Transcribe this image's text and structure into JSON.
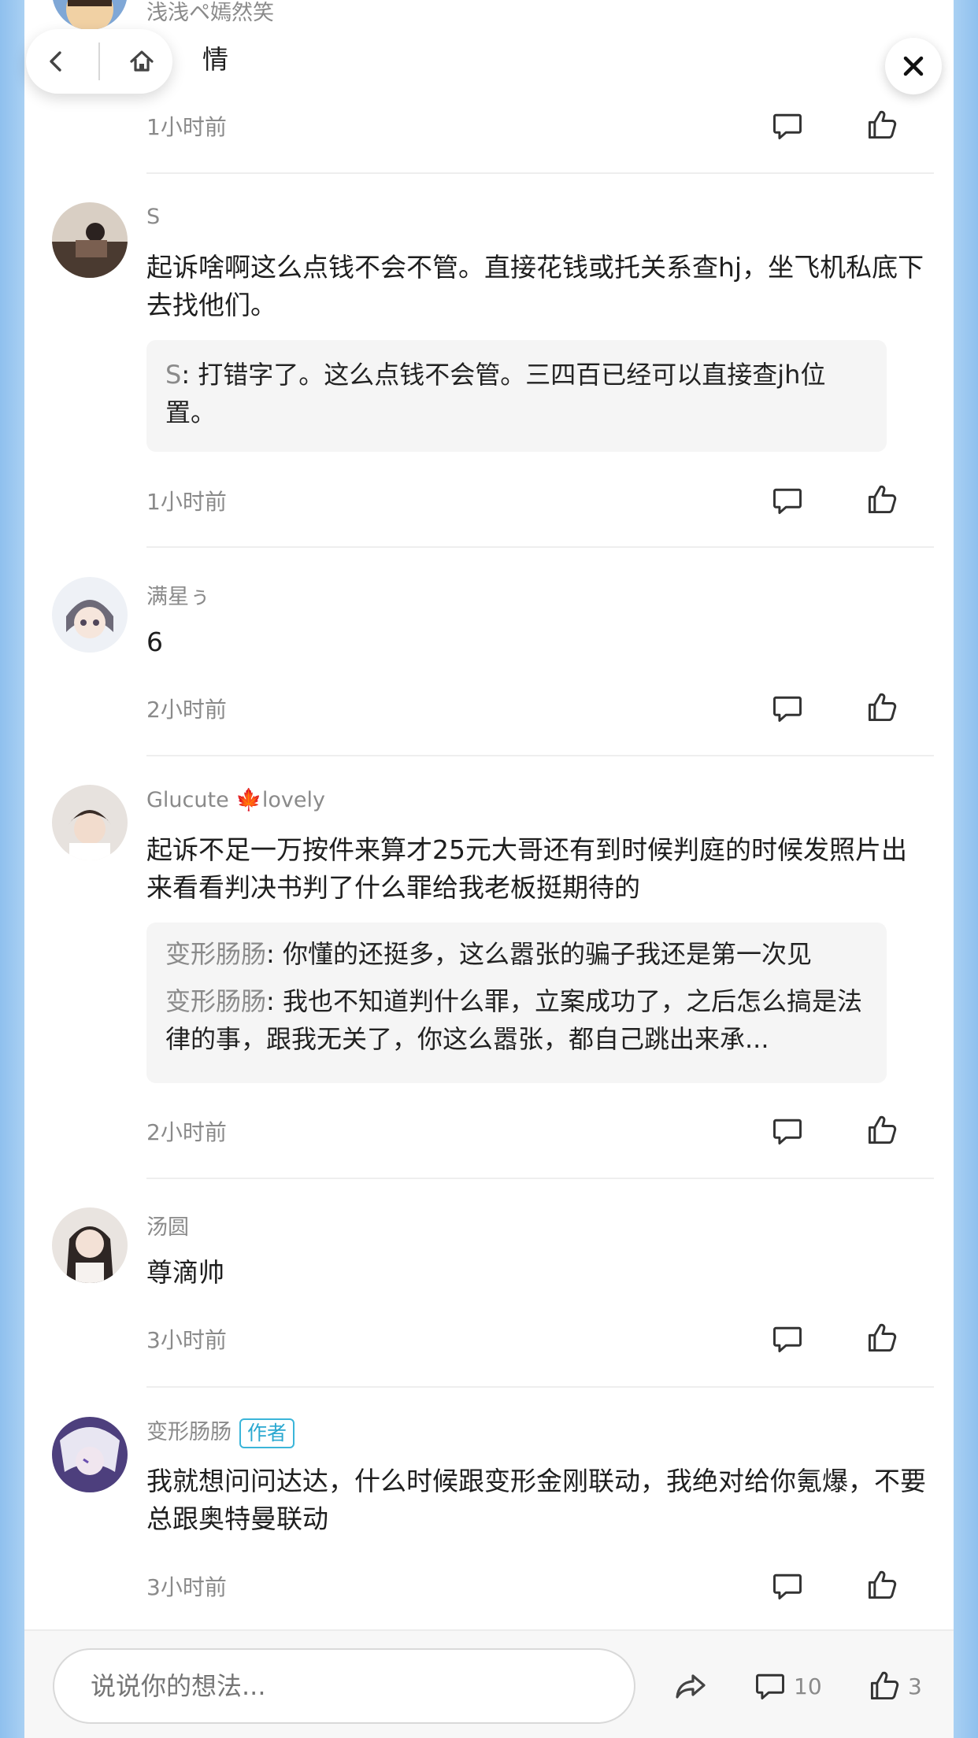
{
  "top_partial": {
    "author": "浅浅ペ嫣然笑",
    "text": "情",
    "time": "1小时前"
  },
  "comments": [
    {
      "author": "S",
      "text": "起诉啥啊这么点钱不会不管。直接花钱或托关系查hj，坐飞机私底下去找他们。",
      "replies": [
        {
          "name": "S",
          "text": "打错字了。这么点钱不会管。三四百已经可以直接查jh位置。"
        }
      ],
      "time": "1小时前"
    },
    {
      "author": "满星ぅ",
      "text": "6",
      "time": "2小时前"
    },
    {
      "author": "Glucute 🍁lovely",
      "text": "起诉不足一万按件来算才25元大哥还有到时候判庭的时候发照片出来看看判决书判了什么罪给我老板挺期待的",
      "replies": [
        {
          "name": "变形肠肠",
          "text": "你懂的还挺多，这么嚣张的骗子我还是第一次见"
        },
        {
          "name": "变形肠肠",
          "text": "我也不知道判什么罪，立案成功了，之后怎么搞是法律的事，跟我无关了，你这么嚣张，都自己跳出来承..."
        }
      ],
      "time": "2小时前"
    },
    {
      "author": "汤圆",
      "text": "尊滴帅",
      "time": "3小时前"
    },
    {
      "author": "变形肠肠",
      "badge": "作者",
      "text": "我就想问问达达，什么时候跟变形金刚联动，我绝对给你氪爆，不要总跟奥特曼联动",
      "time": "3小时前"
    }
  ],
  "bottom_bar": {
    "input_placeholder": "说说你的想法...",
    "comment_count": "10",
    "like_count": "3"
  },
  "colors": {
    "accent_badge": "#2aa8d0",
    "meta_gray": "#8a8a8a",
    "side_blue": "#a9d0f3"
  }
}
